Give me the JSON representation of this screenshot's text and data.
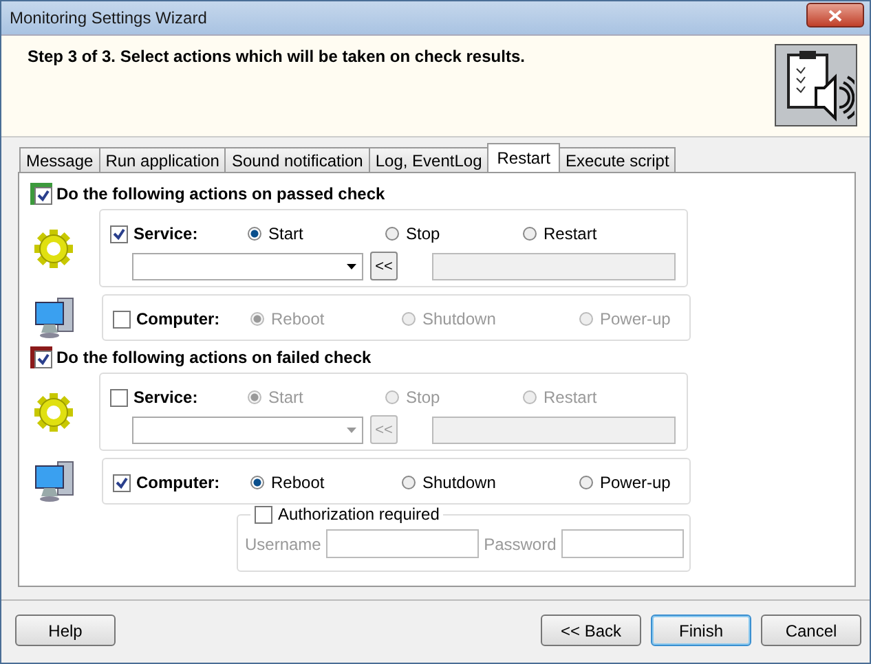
{
  "window": {
    "title": "Monitoring Settings Wizard"
  },
  "header": {
    "step_text": "Step 3 of 3. Select actions which will be taken on check results."
  },
  "tabs": [
    {
      "label": "Message",
      "selected": false
    },
    {
      "label": "Run application",
      "selected": false
    },
    {
      "label": "Sound notification",
      "selected": false
    },
    {
      "label": "Log, EventLog",
      "selected": false
    },
    {
      "label": "Restart",
      "selected": true
    },
    {
      "label": "Execute script",
      "selected": false
    }
  ],
  "sections": [
    {
      "label": "Do the following actions on passed check",
      "checked": true,
      "color": "#3c9a3c",
      "service": {
        "label": "Service:",
        "checked": true,
        "options": [
          {
            "label": "Start",
            "selected": true
          },
          {
            "label": "Stop",
            "selected": false
          },
          {
            "label": "Restart",
            "selected": false
          }
        ],
        "pick_button": "<<"
      },
      "computer": {
        "label": "Computer:",
        "checked": false,
        "options": [
          {
            "label": "Reboot",
            "selected": true
          },
          {
            "label": "Shutdown",
            "selected": false
          },
          {
            "label": "Power-up",
            "selected": false
          }
        ]
      }
    },
    {
      "label": "Do the following actions on failed check",
      "checked": true,
      "color": "#8b1a1a",
      "service": {
        "label": "Service:",
        "checked": false,
        "options": [
          {
            "label": "Start",
            "selected": true
          },
          {
            "label": "Stop",
            "selected": false
          },
          {
            "label": "Restart",
            "selected": false
          }
        ],
        "pick_button": "<<"
      },
      "computer": {
        "label": "Computer:",
        "checked": true,
        "options": [
          {
            "label": "Reboot",
            "selected": true
          },
          {
            "label": "Shutdown",
            "selected": false
          },
          {
            "label": "Power-up",
            "selected": false
          }
        ]
      },
      "authorization": {
        "label": "Authorization required",
        "checked": false,
        "username_label": "Username",
        "password_label": "Password"
      }
    }
  ],
  "buttons": [
    {
      "label": "Help",
      "kind": "left",
      "default": false
    },
    {
      "label": "<< Back",
      "kind": "right",
      "default": false
    },
    {
      "label": "Finish",
      "kind": "right",
      "default": true
    },
    {
      "label": "Cancel",
      "kind": "right",
      "default": false
    }
  ]
}
